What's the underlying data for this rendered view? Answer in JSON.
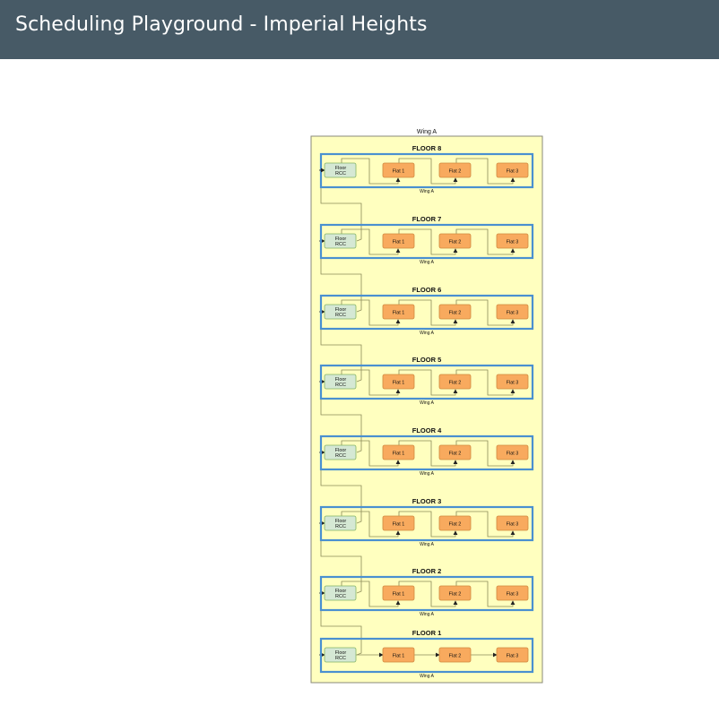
{
  "header": {
    "title": "Scheduling Playground - Imperial Heights"
  },
  "diagram": {
    "wing_title": "Wing A",
    "colors": {
      "wing_fill": "#ffffbf",
      "wing_border": "#8a8a7a",
      "floor_border": "#4a90d0",
      "rcc_fill": "#d5e8d4",
      "rcc_border": "#82b366",
      "flat_fill": "#f8aa5e",
      "flat_border": "#d08a40",
      "connector": "#8a8a5a"
    },
    "floors": [
      {
        "label": "FLOOR 8",
        "footer": "Wing A",
        "rcc": "Floor RCC",
        "flats": [
          "Flat 1",
          "Flat 2",
          "Flat 3"
        ]
      },
      {
        "label": "FLOOR 7",
        "footer": "Wing A",
        "rcc": "Floor RCC",
        "flats": [
          "Flat 1",
          "Flat 2",
          "Flat 3"
        ]
      },
      {
        "label": "FLOOR 6",
        "footer": "Wing A",
        "rcc": "Floor RCC",
        "flats": [
          "Flat 1",
          "Flat 2",
          "Flat 3"
        ]
      },
      {
        "label": "FLOOR 5",
        "footer": "Wing A",
        "rcc": "Floor RCC",
        "flats": [
          "Flat 1",
          "Flat 2",
          "Flat 3"
        ]
      },
      {
        "label": "FLOOR 4",
        "footer": "Wing A",
        "rcc": "Floor RCC",
        "flats": [
          "Flat 1",
          "Flat 2",
          "Flat 3"
        ]
      },
      {
        "label": "FLOOR 3",
        "footer": "Wing A",
        "rcc": "Floor RCC",
        "flats": [
          "Flat 1",
          "Flat 2",
          "Flat 3"
        ]
      },
      {
        "label": "FLOOR 2",
        "footer": "Wing A",
        "rcc": "Floor RCC",
        "flats": [
          "Flat 1",
          "Flat 2",
          "Flat 3"
        ]
      },
      {
        "label": "FLOOR 1",
        "footer": "Wing A",
        "rcc": "Floor RCC",
        "flats": [
          "Flat 1",
          "Flat 2",
          "Flat 3"
        ]
      }
    ]
  }
}
